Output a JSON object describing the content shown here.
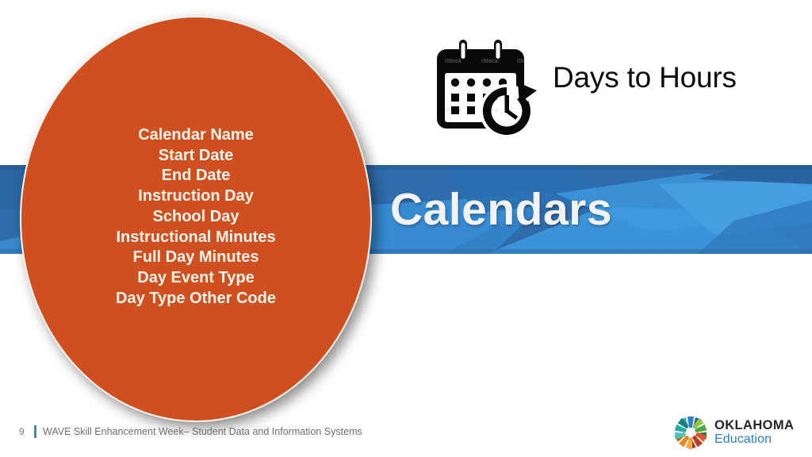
{
  "slide": {
    "page_number": "9",
    "footer_text": "WAVE Skill Enhancement Week– Student Data and Information Systems"
  },
  "banner": {
    "title": "Calendars",
    "base_color": "#2f6cab",
    "accent_color": "#3d95d8",
    "dark_color": "#235d9c"
  },
  "ellipse": {
    "fill_color": "#cf4f21",
    "border_color": "#fdf6ee",
    "lines": [
      "Calendar Name",
      "Start Date",
      "End Date",
      "Instruction Day",
      "School Day",
      "Instructional Minutes",
      "Full Day Minutes",
      "Day Event Type",
      "Day Type Other Code"
    ]
  },
  "days_to_hours": {
    "label": "Days to Hours",
    "icon": "calendar-clock-icon",
    "watermark": "iStock"
  },
  "logo": {
    "mark": "oklahoma-pinwheel-icon",
    "line1": "OKLAHOMA",
    "line2": "Education",
    "line1_color": "#23272b",
    "line2_color": "#2b7cc2"
  }
}
